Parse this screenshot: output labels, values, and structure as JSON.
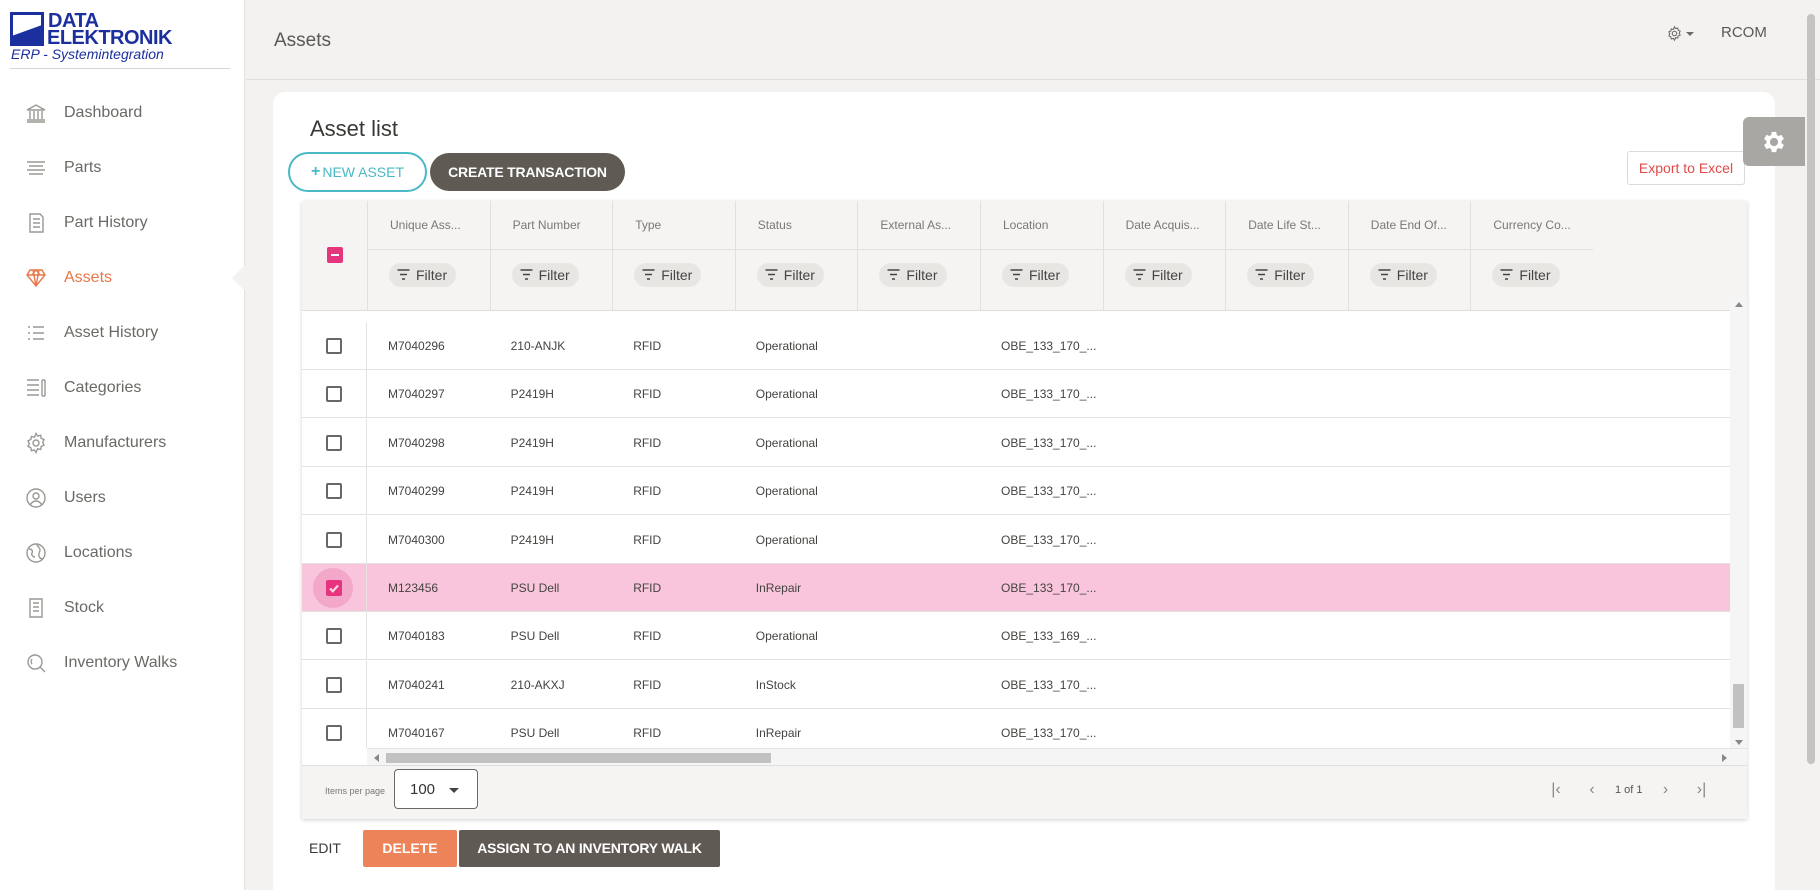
{
  "logo": {
    "line1": "DATA",
    "line2": "ELEKTRONIK",
    "line3": "ERP - Systemintegration"
  },
  "sidebar": {
    "items": [
      {
        "label": "Dashboard",
        "icon": "bank-icon",
        "active": false
      },
      {
        "label": "Parts",
        "icon": "lines-icon",
        "active": false
      },
      {
        "label": "Part History",
        "icon": "document-icon",
        "active": false
      },
      {
        "label": "Assets",
        "icon": "diamond-icon",
        "active": true
      },
      {
        "label": "Asset History",
        "icon": "list-icon",
        "active": false
      },
      {
        "label": "Categories",
        "icon": "categories-icon",
        "active": false
      },
      {
        "label": "Manufacturers",
        "icon": "gear-icon",
        "active": false
      },
      {
        "label": "Users",
        "icon": "user-icon",
        "active": false
      },
      {
        "label": "Locations",
        "icon": "globe-icon",
        "active": false
      },
      {
        "label": "Stock",
        "icon": "clipboard-icon",
        "active": false
      },
      {
        "label": "Inventory Walks",
        "icon": "search-icon",
        "active": false
      }
    ]
  },
  "header": {
    "title": "Assets",
    "user": "RCOM"
  },
  "main": {
    "title": "Asset list",
    "new_asset_label": "NEW ASSET",
    "create_transaction_label": "CREATE TRANSACTION",
    "export_label": "Export to Excel",
    "filter_label": "Filter",
    "columns": [
      "Unique Ass...",
      "Part Number",
      "Type",
      "Status",
      "External As...",
      "Location",
      "Date Acquis...",
      "Date Life St...",
      "Date End Of...",
      "Currency Co..."
    ],
    "rows": [
      {
        "id": "M7040296",
        "part": "210-ANJK",
        "type": "RFID",
        "status": "Operational",
        "location": "OBE_133_170_...",
        "selected": false
      },
      {
        "id": "M7040297",
        "part": "P2419H",
        "type": "RFID",
        "status": "Operational",
        "location": "OBE_133_170_...",
        "selected": false
      },
      {
        "id": "M7040298",
        "part": "P2419H",
        "type": "RFID",
        "status": "Operational",
        "location": "OBE_133_170_...",
        "selected": false
      },
      {
        "id": "M7040299",
        "part": "P2419H",
        "type": "RFID",
        "status": "Operational",
        "location": "OBE_133_170_...",
        "selected": false
      },
      {
        "id": "M7040300",
        "part": "P2419H",
        "type": "RFID",
        "status": "Operational",
        "location": "OBE_133_170_...",
        "selected": false
      },
      {
        "id": "M123456",
        "part": "PSU Dell",
        "type": "RFID",
        "status": "InRepair",
        "location": "OBE_133_170_...",
        "selected": true
      },
      {
        "id": "M7040183",
        "part": "PSU Dell",
        "type": "RFID",
        "status": "Operational",
        "location": "OBE_133_169_...",
        "selected": false
      },
      {
        "id": "M7040241",
        "part": "210-AKXJ",
        "type": "RFID",
        "status": "InStock",
        "location": "OBE_133_170_...",
        "selected": false
      },
      {
        "id": "M7040167",
        "part": "PSU Dell",
        "type": "RFID",
        "status": "InRepair",
        "location": "OBE_133_170_...",
        "selected": false
      }
    ],
    "pagination": {
      "items_per_page_label": "Items per page",
      "items_per_page": "100",
      "page_info": "1 of 1"
    },
    "actions": {
      "edit": "EDIT",
      "delete": "DELETE",
      "assign": "ASSIGN TO AN INVENTORY WALK"
    }
  },
  "colors": {
    "accent": "#e8774a",
    "primary": "#e6357f",
    "teal": "#49b9c5",
    "dark_button": "#5f5a53",
    "selected_row": "#f8c5dc",
    "export_text": "#e24a4a"
  }
}
